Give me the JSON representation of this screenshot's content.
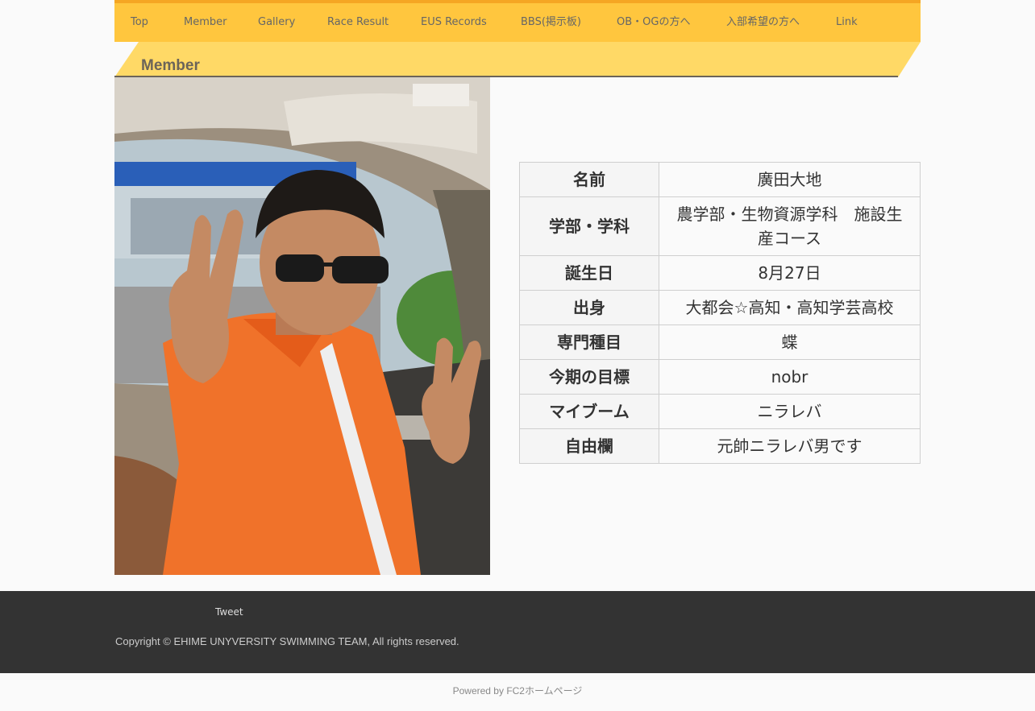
{
  "nav": {
    "items": [
      {
        "label": "Top"
      },
      {
        "label": "Member"
      },
      {
        "label": "Gallery"
      },
      {
        "label": "Race Result"
      },
      {
        "label": "EUS Records"
      },
      {
        "label": "BBS(掲示板)"
      },
      {
        "label": "OB・OGの方へ"
      },
      {
        "label": "入部希望の方へ"
      },
      {
        "label": "Link"
      }
    ]
  },
  "page": {
    "title": "Member"
  },
  "profile": {
    "rows": [
      {
        "label": "名前",
        "value": "廣田大地"
      },
      {
        "label": "学部・学科",
        "value": "農学部・生物資源学科　施設生産コース"
      },
      {
        "label": "誕生日",
        "value": "8月27日"
      },
      {
        "label": "出身",
        "value": "大都会☆高知・高知学芸高校"
      },
      {
        "label": "専門種目",
        "value": "蝶"
      },
      {
        "label": "今期の目標",
        "value": "nobr"
      },
      {
        "label": "マイブーム",
        "value": "ニラレバ"
      },
      {
        "label": "自由欄",
        "value": "元帥ニラレバ男です"
      }
    ]
  },
  "footer": {
    "tweet": "Tweet",
    "copyright": "Copyright © EHIME UNYVERSITY SWIMMING TEAM, All rights reserved.",
    "powered_prefix": "Powered by ",
    "powered_link": "FC2ホームページ"
  },
  "colors": {
    "nav_bg": "#ffc63e",
    "nav_top_border": "#f5a623",
    "band_bg": "#ffd966",
    "footer_bg": "#333333"
  }
}
